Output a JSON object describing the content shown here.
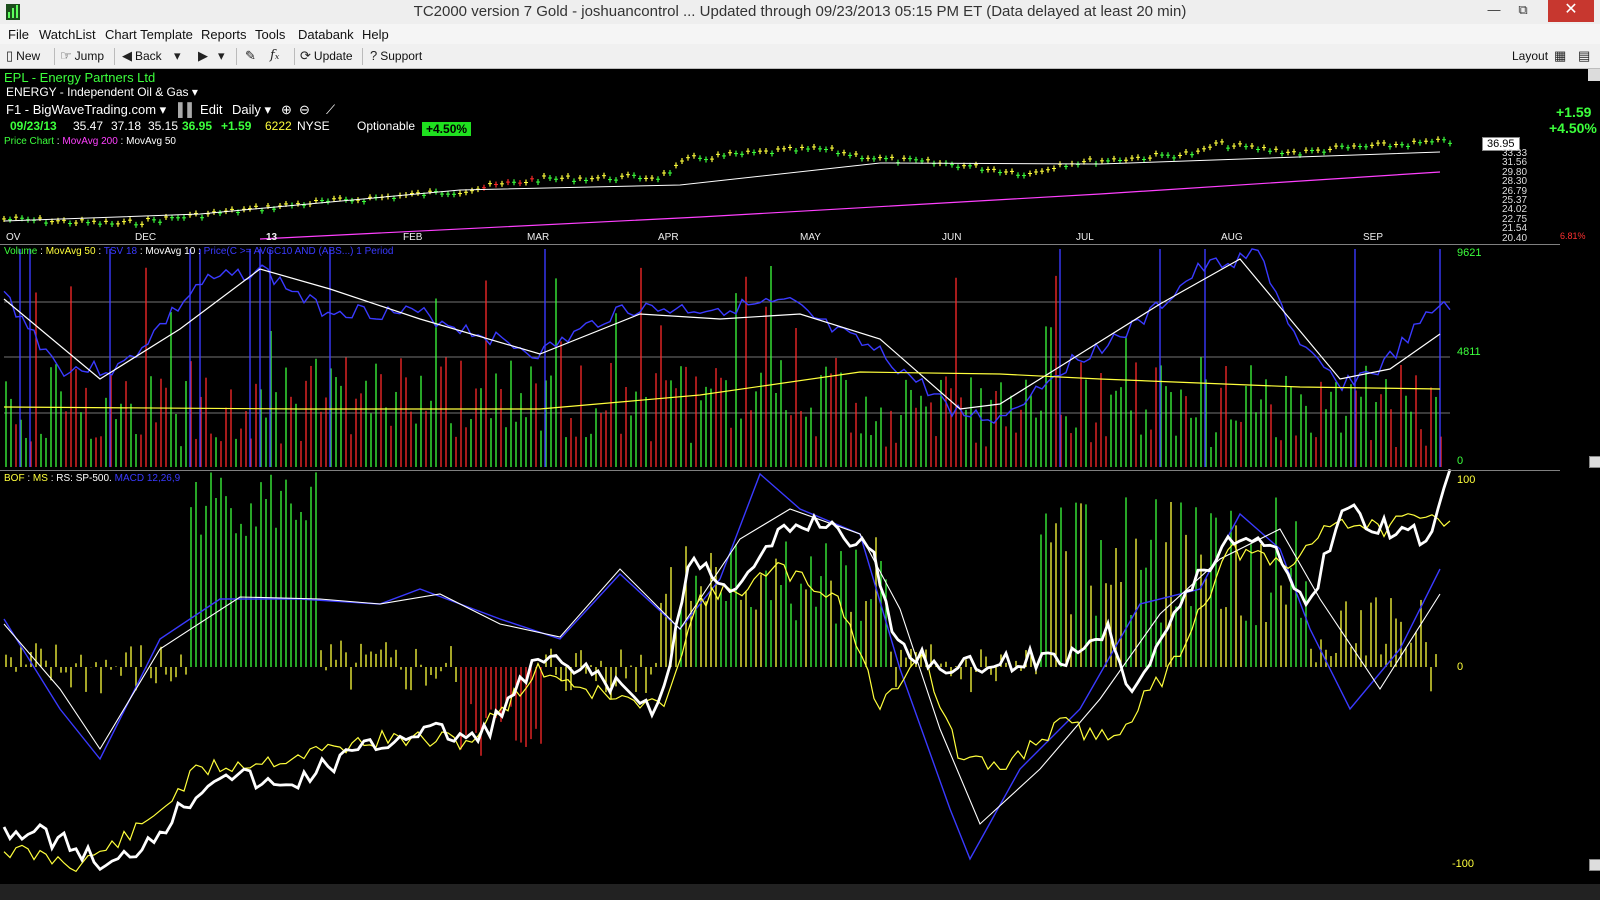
{
  "window": {
    "title": "TC2000 version 7 Gold - joshuancontrol   ... Updated through 09/23/2013  05:15 PM ET  (Data delayed at least 20 min)"
  },
  "menu": [
    "File",
    "WatchList",
    "Chart Template",
    "Reports",
    "Tools",
    "Databank",
    "Help"
  ],
  "toolbar": {
    "new": "New",
    "jump": "Jump",
    "back": "Back",
    "update": "Update",
    "support": "Support",
    "layout": "Layout"
  },
  "symbol": {
    "name": "EPL - Energy Partners Ltd",
    "industry": "ENERGY - Independent Oil & Gas",
    "watchlist": "F1 - BigWaveTrading.com",
    "edit": "Edit",
    "timeframe": "Daily",
    "date": "09/23/13",
    "open": "35.47",
    "high": "37.18",
    "low": "35.15",
    "close": "36.95",
    "change": "+1.59",
    "volume": "6222",
    "exchange": "NYSE",
    "optionable": "Optionable",
    "pct_badge": "+4.50%",
    "change_big": "+1.59",
    "pct_big": "+4.50%",
    "last_price": "36.95"
  },
  "price_pane": {
    "legend": {
      "label": "Price Chart",
      "ma200": "MovAvg 200",
      "ma50": "MovAvg 50"
    },
    "months": [
      "OV",
      "DEC",
      "13",
      "FEB",
      "MAR",
      "APR",
      "MAY",
      "JUN",
      "JUL",
      "AUG",
      "SEP"
    ],
    "scale": [
      "33.33",
      "31.56",
      "29.80",
      "28.30",
      "26.79",
      "25.37",
      "24.02",
      "22.75",
      "21.54",
      "20.40"
    ],
    "pct_small": "6.81%"
  },
  "volume_pane": {
    "legend": {
      "volume": "Volume",
      "ma50": "MovAvg 50",
      "tsv": "TSV 18",
      "ma10": "MovAvg 10",
      "cond": "Price(C >= AVGC10 AND (ABS...) 1 Period"
    },
    "scale": [
      "9621",
      "4811",
      "0"
    ]
  },
  "osc_pane": {
    "legend": {
      "bof": "BOF",
      "ms": "MS",
      "rs": "RS: SP-500.",
      "macd": "MACD 12,26,9"
    },
    "scale": [
      "100",
      "0",
      "-100"
    ]
  },
  "colors": {
    "up": "#3cff3c",
    "down": "#ff2a2a",
    "ma200": "#ff40ff",
    "ma50": "#ffffff",
    "tsv": "#3a3aff",
    "yellow": "#ffff3c",
    "background": "#000000"
  }
}
